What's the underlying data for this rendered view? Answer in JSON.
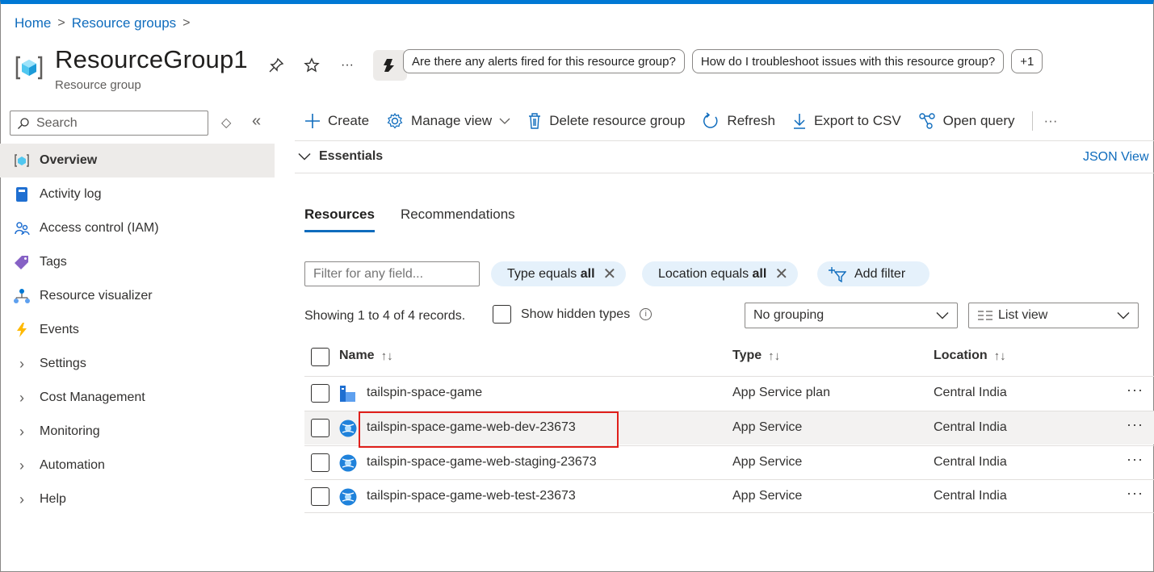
{
  "breadcrumb": {
    "home": "Home",
    "resource_groups": "Resource groups",
    "sep": ">"
  },
  "header": {
    "title": "ResourceGroup1",
    "subtitle": "Resource group",
    "icons": [
      "pin-icon",
      "star-icon",
      "more-icon",
      "copilot-icon"
    ],
    "more": "···",
    "suggestions": [
      "Are there any alerts fired for this resource group?",
      "How do I troubleshoot issues with this resource group?"
    ],
    "suggestions_more": "+1"
  },
  "sidebar": {
    "search_placeholder": "Search",
    "items": [
      {
        "label": "Overview",
        "icon": "resource-group-icon",
        "active": true
      },
      {
        "label": "Activity log",
        "icon": "activity-log-icon"
      },
      {
        "label": "Access control (IAM)",
        "icon": "iam-icon"
      },
      {
        "label": "Tags",
        "icon": "tag-icon"
      },
      {
        "label": "Resource visualizer",
        "icon": "visualizer-icon"
      },
      {
        "label": "Events",
        "icon": "lightning-icon"
      },
      {
        "label": "Settings",
        "expandable": true
      },
      {
        "label": "Cost Management",
        "expandable": true
      },
      {
        "label": "Monitoring",
        "expandable": true
      },
      {
        "label": "Automation",
        "expandable": true
      },
      {
        "label": "Help",
        "expandable": true
      }
    ]
  },
  "toolbar": {
    "create": "Create",
    "manage_view": "Manage view",
    "delete": "Delete resource group",
    "refresh": "Refresh",
    "export": "Export to CSV",
    "open_query": "Open query",
    "more": "···"
  },
  "essentials": {
    "label": "Essentials",
    "json_view": "JSON View"
  },
  "tabs": [
    {
      "label": "Resources",
      "active": true
    },
    {
      "label": "Recommendations"
    }
  ],
  "filters": {
    "placeholder": "Filter for any field...",
    "type_pill": {
      "text": "Type equals ",
      "value": "all"
    },
    "location_pill": {
      "text": "Location equals ",
      "value": "all"
    },
    "add_filter": "Add filter"
  },
  "records": {
    "showing": "Showing 1 to 4 of 4 records.",
    "show_hidden": "Show hidden types",
    "grouping": "No grouping",
    "view": "List view"
  },
  "table": {
    "columns": [
      "Name",
      "Type",
      "Location"
    ],
    "sort_glyph": "↑↓",
    "rows": [
      {
        "name": "tailspin-space-game",
        "type": "App Service plan",
        "location": "Central India",
        "icon": "app-service-plan-icon"
      },
      {
        "name": "tailspin-space-game-web-dev-23673",
        "type": "App Service",
        "location": "Central India",
        "icon": "app-service-icon",
        "highlighted": true
      },
      {
        "name": "tailspin-space-game-web-staging-23673",
        "type": "App Service",
        "location": "Central India",
        "icon": "app-service-icon"
      },
      {
        "name": "tailspin-space-game-web-test-23673",
        "type": "App Service",
        "location": "Central India",
        "icon": "app-service-icon"
      }
    ],
    "row_more": "···"
  },
  "colors": {
    "accent": "#0078d4",
    "link": "#0f6cbd",
    "highlight_box": "#e0201b",
    "pill_bg": "#e5f1fb"
  }
}
